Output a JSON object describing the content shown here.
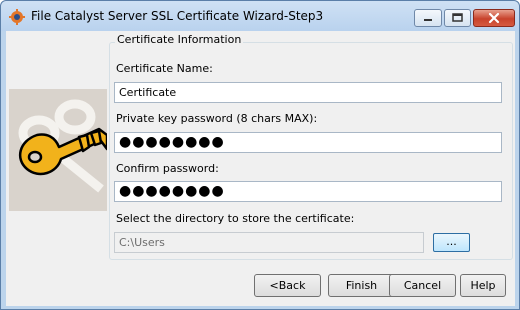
{
  "window": {
    "title": "File Catalyst Server SSL Certificate Wizard-Step3"
  },
  "form": {
    "group_title": "Certificate Information",
    "cert_name_label": "Certificate Name:",
    "cert_name_value": "Certificate",
    "key_password_label": "Private key password (8 chars MAX):",
    "key_password_value": "●●●●●●●●",
    "confirm_password_label": "Confirm password:",
    "confirm_password_value": "●●●●●●●●",
    "directory_label": "Select the directory to store the certificate:",
    "directory_value": "C:\\Users",
    "browse_label": "..."
  },
  "buttons": {
    "back": "<Back",
    "finish": "Finish",
    "cancel": "Cancel",
    "help": "Help"
  },
  "icons": {
    "app": "app-logo-icon",
    "side": "key-icon"
  }
}
